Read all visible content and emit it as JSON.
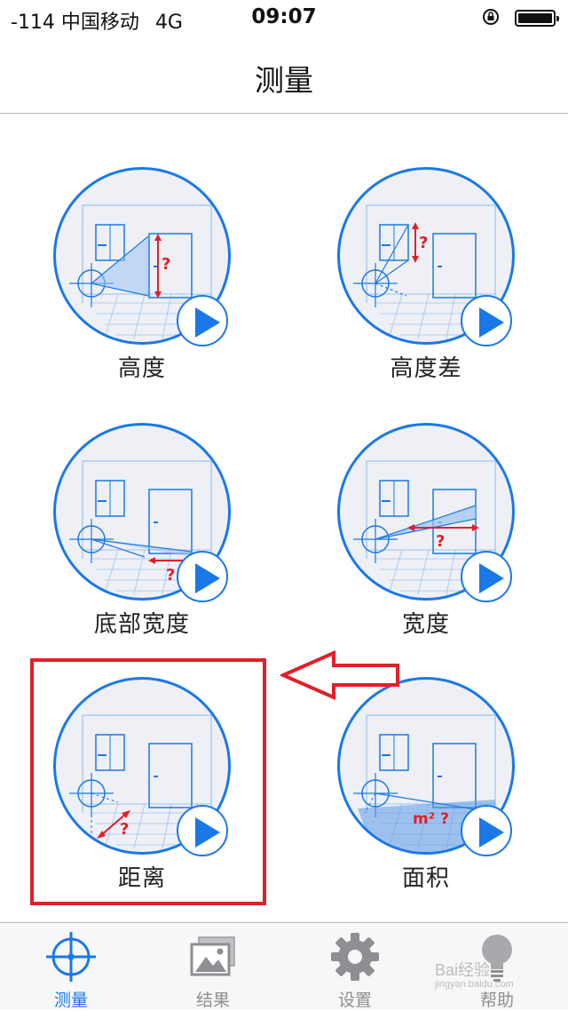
{
  "status_bar": {
    "carrier": "-114 中国移动",
    "network": "4G",
    "time": "09:07",
    "icons": [
      "orientation-lock-icon",
      "battery-icon"
    ]
  },
  "header": {
    "title": "测量"
  },
  "tools": [
    {
      "label": "高度",
      "illustration": "height-measure-icon"
    },
    {
      "label": "高度差",
      "illustration": "height-difference-icon"
    },
    {
      "label": "底部宽度",
      "illustration": "bottom-width-icon"
    },
    {
      "label": "宽度",
      "illustration": "width-measure-icon"
    },
    {
      "label": "距离",
      "illustration": "distance-measure-icon"
    },
    {
      "label": "面积",
      "illustration": "area-measure-icon",
      "badge": "m² ?"
    }
  ],
  "illustration_mark": "?",
  "annotation": {
    "highlighted_tool": "距离",
    "color": "#e0202a"
  },
  "tab_bar": {
    "active": "测量",
    "tabs": [
      {
        "label": "测量",
        "icon": "crosshair-icon"
      },
      {
        "label": "结果",
        "icon": "photo-gallery-icon"
      },
      {
        "label": "设置",
        "icon": "gear-icon"
      },
      {
        "label": "帮助",
        "icon": "lightbulb-icon"
      }
    ]
  },
  "watermark": {
    "text": "Bai经验",
    "url_text": "jingyan.baidu.com"
  },
  "colors": {
    "accent": "#1a78e8",
    "annotation": "#e0202a",
    "tab_inactive": "#8e8e93"
  }
}
